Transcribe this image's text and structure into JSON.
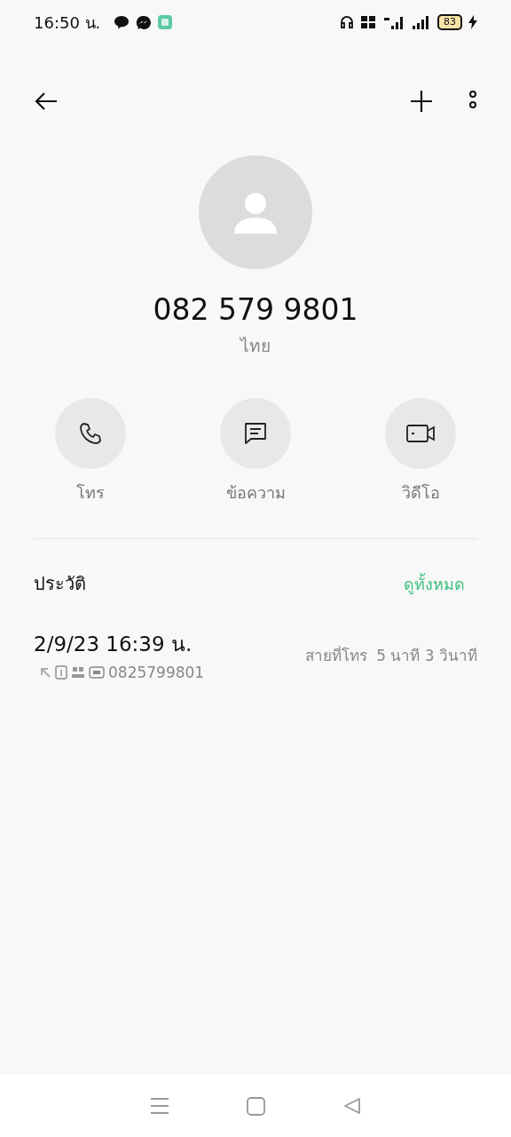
{
  "status_bar": {
    "time": "16:50 น.",
    "battery": "83"
  },
  "contact": {
    "number": "082 579 9801",
    "location": "ไทย"
  },
  "actions": [
    {
      "kind": "call",
      "label": "โทร"
    },
    {
      "kind": "message",
      "label": "ข้อความ"
    },
    {
      "kind": "video",
      "label": "วิดีโอ"
    }
  ],
  "history": {
    "title": "ประวัติ",
    "view_all": "ดูทั้งหมด",
    "entries": [
      {
        "datetime": "2/9/23 16:39 น.",
        "number": "0825799801",
        "type": "สายที่โทร",
        "duration": "5 นาที 3 วินาที"
      }
    ]
  }
}
